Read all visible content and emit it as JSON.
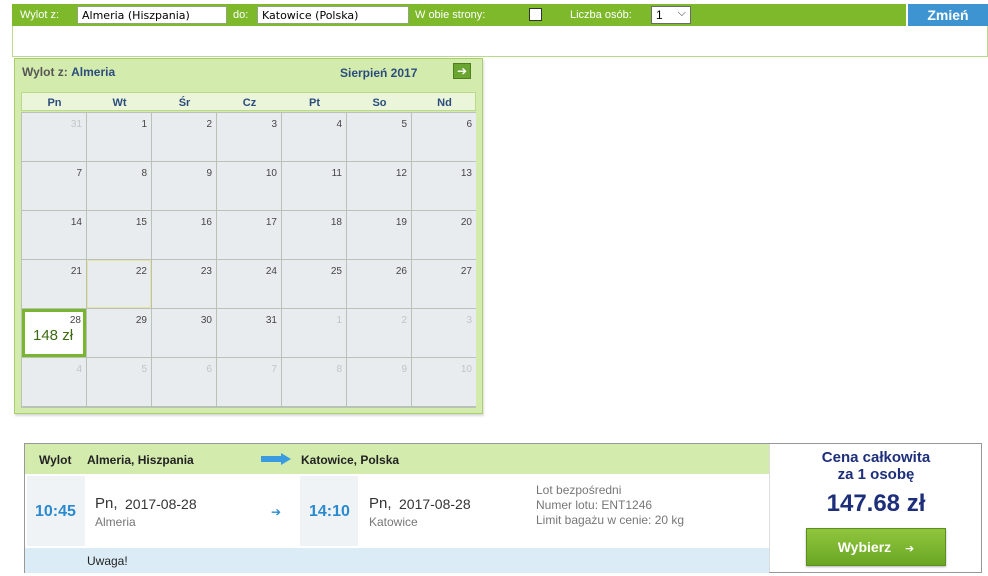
{
  "search": {
    "from_label": "Wylot z:",
    "from_value": "Almeria (Hiszpania)",
    "to_label": "do:",
    "to_value": "Katowice (Polska)",
    "roundtrip_label": "W obie strony:",
    "roundtrip_checked": false,
    "persons_label": "Liczba osób:",
    "persons_value": "1",
    "submit_label": "Zmień"
  },
  "calendar": {
    "from_prefix": "Wylot z:",
    "from_city": "Almeria",
    "month": "Sierpień 2017",
    "weekdays": [
      "Pn",
      "Wt",
      "Śr",
      "Cz",
      "Pt",
      "So",
      "Nd"
    ],
    "weeks": [
      [
        "31",
        "1",
        "2",
        "3",
        "4",
        "5",
        "6"
      ],
      [
        "7",
        "8",
        "9",
        "10",
        "11",
        "12",
        "13"
      ],
      [
        "14",
        "15",
        "16",
        "17",
        "18",
        "19",
        "20"
      ],
      [
        "21",
        "22",
        "23",
        "24",
        "25",
        "26",
        "27"
      ],
      [
        "28",
        "29",
        "30",
        "31",
        "1",
        "2",
        "3"
      ],
      [
        "4",
        "5",
        "6",
        "7",
        "8",
        "9",
        "10"
      ]
    ],
    "selected_day": "28",
    "selected_price": "148 zł"
  },
  "flight": {
    "header_label": "Wylot",
    "origin": "Almeria, Hiszpania",
    "destination": "Katowice, Polska",
    "depart_time": "10:45",
    "depart_day": "Pn,",
    "depart_date": "2017-08-28",
    "depart_city": "Almeria",
    "arrive_time": "14:10",
    "arrive_day": "Pn,",
    "arrive_date": "2017-08-28",
    "arrive_city": "Katowice",
    "info_direct": "Lot bezpośredni",
    "info_flight_number": "Numer lotu: ENT1246",
    "info_baggage": "Limit bagażu w cenie: 20 kg",
    "notice": "Uwaga!"
  },
  "price": {
    "title_line1": "Cena całkowita",
    "title_line2": "za 1 osobę",
    "amount": "147.68 zł",
    "select_label": "Wybierz"
  },
  "icons": {
    "next_month": "arrow-right-icon",
    "route": "arrow-right-icon",
    "button": "arrow-right-icon"
  },
  "colors": {
    "accent_green": "#7db92b",
    "accent_blue": "#3d94d0",
    "price_blue": "#1d2f7a",
    "time_blue": "#2a8ad0"
  }
}
